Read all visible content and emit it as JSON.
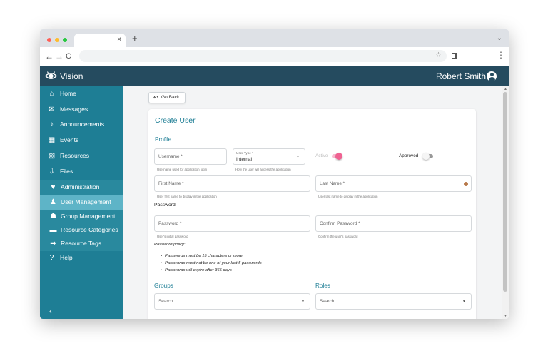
{
  "browser": {
    "tab_close": "×",
    "new_tab": "+",
    "tab_menu": "⌄",
    "back": "←",
    "forward": "→",
    "reload": "C",
    "star": "☆",
    "menu": "⋮"
  },
  "header": {
    "app_name": "Vision",
    "user_name": "Robert Smith",
    "logo_icon": "eye-icon",
    "avatar_icon": "user-circle-icon",
    "color": "#254b5f"
  },
  "sidebar": {
    "color": "#1e7e95",
    "active_color": "#5eb4c7",
    "items": [
      {
        "label": "Home",
        "icon": "home-icon",
        "glyph": "⌂"
      },
      {
        "label": "Messages",
        "icon": "envelope-icon",
        "glyph": "✉"
      },
      {
        "label": "Announcements",
        "icon": "bell-icon",
        "glyph": "♪"
      },
      {
        "label": "Events",
        "icon": "calendar-icon",
        "glyph": "▦"
      },
      {
        "label": "Resources",
        "icon": "image-icon",
        "glyph": "▨"
      },
      {
        "label": "Files",
        "icon": "download-icon",
        "glyph": "⇩"
      },
      {
        "label": "Administration",
        "icon": "shield-icon",
        "glyph": "♥"
      },
      {
        "label": "User Management",
        "icon": "user-icon",
        "glyph": "♟"
      },
      {
        "label": "Group Management",
        "icon": "users-icon",
        "glyph": "☗"
      },
      {
        "label": "Resource Categories",
        "icon": "list-icon",
        "glyph": "▬"
      },
      {
        "label": "Resource Tags",
        "icon": "tag-icon",
        "glyph": "➡"
      },
      {
        "label": "Help",
        "icon": "question-icon",
        "glyph": "?"
      }
    ],
    "collapse": "‹"
  },
  "content": {
    "go_back": {
      "arrow": "↶",
      "label": "Go Back"
    },
    "title": "Create User",
    "profile_label": "Profile",
    "username": {
      "placeholder": "Username *",
      "help": "Username used for application login"
    },
    "user_type": {
      "label": "User Type *",
      "value": "Internal",
      "help": "How the user will access the application",
      "caret": "▼"
    },
    "active": {
      "label": "Active",
      "on": true,
      "color": "#f06292"
    },
    "approved": {
      "label": "Approved",
      "on": false
    },
    "first_name": {
      "placeholder": "First Name *",
      "help": "User first name to display in the application"
    },
    "last_name": {
      "placeholder": "Last Name *",
      "help": "User last name to display in the application"
    },
    "password_label": "Password",
    "password": {
      "placeholder": "Password *",
      "help": "User's initial password"
    },
    "confirm_password": {
      "placeholder": "Confirm Password *",
      "help": "Confirm the user's password"
    },
    "policy": {
      "title": "Password policy:",
      "items": [
        "Passwords must be 15 characters or more",
        "Passwords must not be one of your last 5 passwords",
        "Passwords will expire after 365 days"
      ]
    },
    "groups": {
      "label": "Groups",
      "placeholder": "Search..."
    },
    "roles": {
      "label": "Roles",
      "placeholder": "Search..."
    },
    "select_caret": "▼"
  },
  "scrollbar": {
    "up": "▲",
    "down": "▼"
  }
}
